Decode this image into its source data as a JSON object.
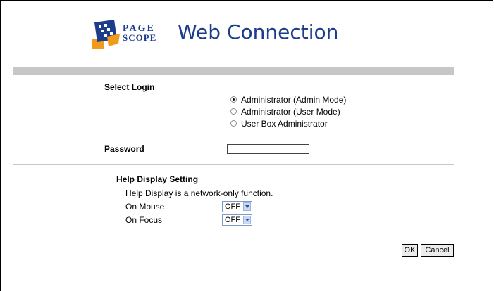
{
  "header": {
    "brand_line1": "PAGE",
    "brand_line2": "SCOPE",
    "title": "Web Connection"
  },
  "login": {
    "select_label": "Select Login",
    "options": [
      {
        "label": "Administrator (Admin Mode)",
        "checked": true
      },
      {
        "label": "Administrator (User Mode)",
        "checked": false
      },
      {
        "label": "User Box Administrator",
        "checked": false
      }
    ],
    "password_label": "Password",
    "password_value": ""
  },
  "help": {
    "heading": "Help Display Setting",
    "note": "Help Display is a network-only function.",
    "on_mouse_label": "On Mouse",
    "on_mouse_value": "OFF",
    "on_focus_label": "On Focus",
    "on_focus_value": "OFF"
  },
  "actions": {
    "ok_label": "OK",
    "cancel_label": "Cancel"
  },
  "colors": {
    "brand_blue": "#1c3c8c",
    "bar_gray": "#c7c7c7"
  }
}
